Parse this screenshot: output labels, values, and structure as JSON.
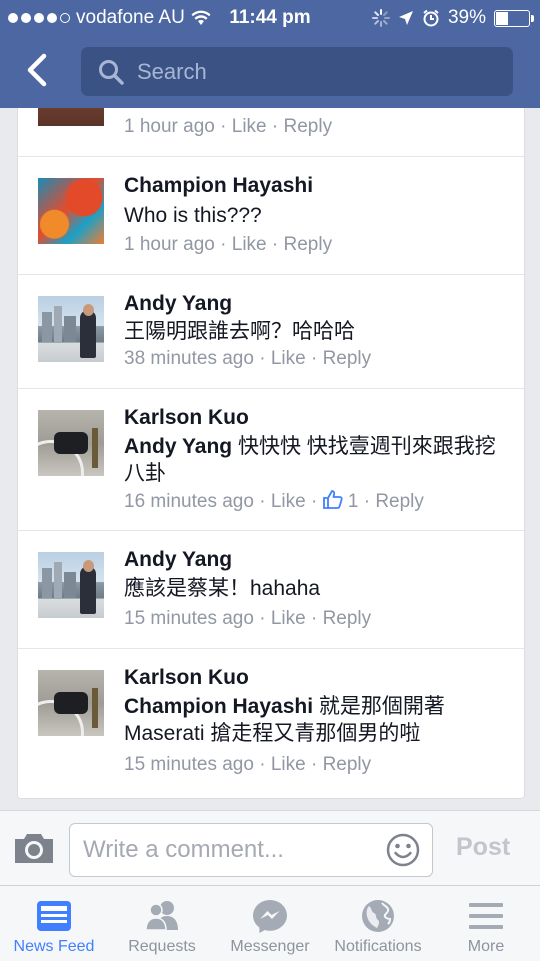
{
  "status_bar": {
    "carrier": "vodafone AU",
    "time": "11:44 pm",
    "battery_pct": "39%"
  },
  "header": {
    "search_placeholder": "Search",
    "back_icon": "chevron-left-icon",
    "search_icon": "search-icon"
  },
  "comments": [
    {
      "name": "",
      "text": "",
      "time": "1 hour ago",
      "like": "Like",
      "reply": "Reply",
      "sep": "·"
    },
    {
      "name": "Champion Hayashi",
      "text": "Who is this???",
      "time": "1 hour ago",
      "like": "Like",
      "reply": "Reply",
      "sep": "·"
    },
    {
      "name": "Andy Yang",
      "text": "王陽明跟誰去啊？哈哈哈",
      "time": "38 minutes ago",
      "like": "Like",
      "reply": "Reply",
      "sep": "·"
    },
    {
      "name": "Karlson Kuo",
      "mention": "Andy Yang",
      "text": " 快快快 快找壹週刊來跟我挖八卦",
      "time": "16 minutes ago",
      "like": "Like",
      "likes_count": "1",
      "reply": "Reply",
      "sep": "·"
    },
    {
      "name": "Andy Yang",
      "text": "應該是蔡某！hahaha",
      "time": "15 minutes ago",
      "like": "Like",
      "reply": "Reply",
      "sep": "·"
    },
    {
      "name": "Karlson Kuo",
      "mention": "Champion Hayashi",
      "text": " 就是那個開著Maserati 搶走程又青那個男的啦",
      "time": "15 minutes ago",
      "like": "Like",
      "reply": "Reply",
      "sep": "·"
    }
  ],
  "composer": {
    "placeholder": "Write a comment...",
    "post_label": "Post",
    "camera_icon": "camera-icon",
    "emoji_icon": "smiley-icon"
  },
  "tabs": [
    {
      "label": "News Feed",
      "icon": "news-feed-icon",
      "active": true
    },
    {
      "label": "Requests",
      "icon": "friend-requests-icon",
      "active": false
    },
    {
      "label": "Messenger",
      "icon": "messenger-icon",
      "active": false
    },
    {
      "label": "Notifications",
      "icon": "globe-icon",
      "active": false
    },
    {
      "label": "More",
      "icon": "hamburger-menu-icon",
      "active": false
    }
  ],
  "colors": {
    "header_blue": "#4c67a1",
    "link_blue": "#4080ff",
    "meta_gray": "#9197a3"
  }
}
